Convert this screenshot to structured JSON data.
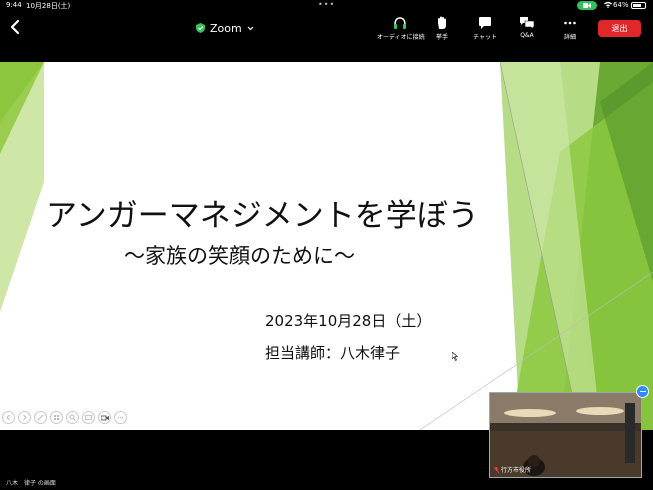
{
  "status_bar": {
    "time": "9:44",
    "date": "10月28日(土)",
    "battery": "64%"
  },
  "toolbar": {
    "meeting_title": "Zoom",
    "audio_label": "オーディオに接続",
    "raise_hand_label": "挙手",
    "chat_label": "チャット",
    "qa_label": "Q&A",
    "more_label": "詳細",
    "leave_label": "退出"
  },
  "slide": {
    "title": "アンガーマネジメントを学ぼう",
    "subtitle": "～家族の笑顔のために～",
    "date": "2023年10月28日（土）",
    "lecturer": "担当講師：八木律子"
  },
  "video": {
    "participant_name": "行方市役所"
  },
  "screen_owner": "八木　律子 の画面",
  "colors": {
    "accent_green": "#7dc242",
    "leave_red": "#e0272a",
    "shield_green": "#36c25c"
  }
}
